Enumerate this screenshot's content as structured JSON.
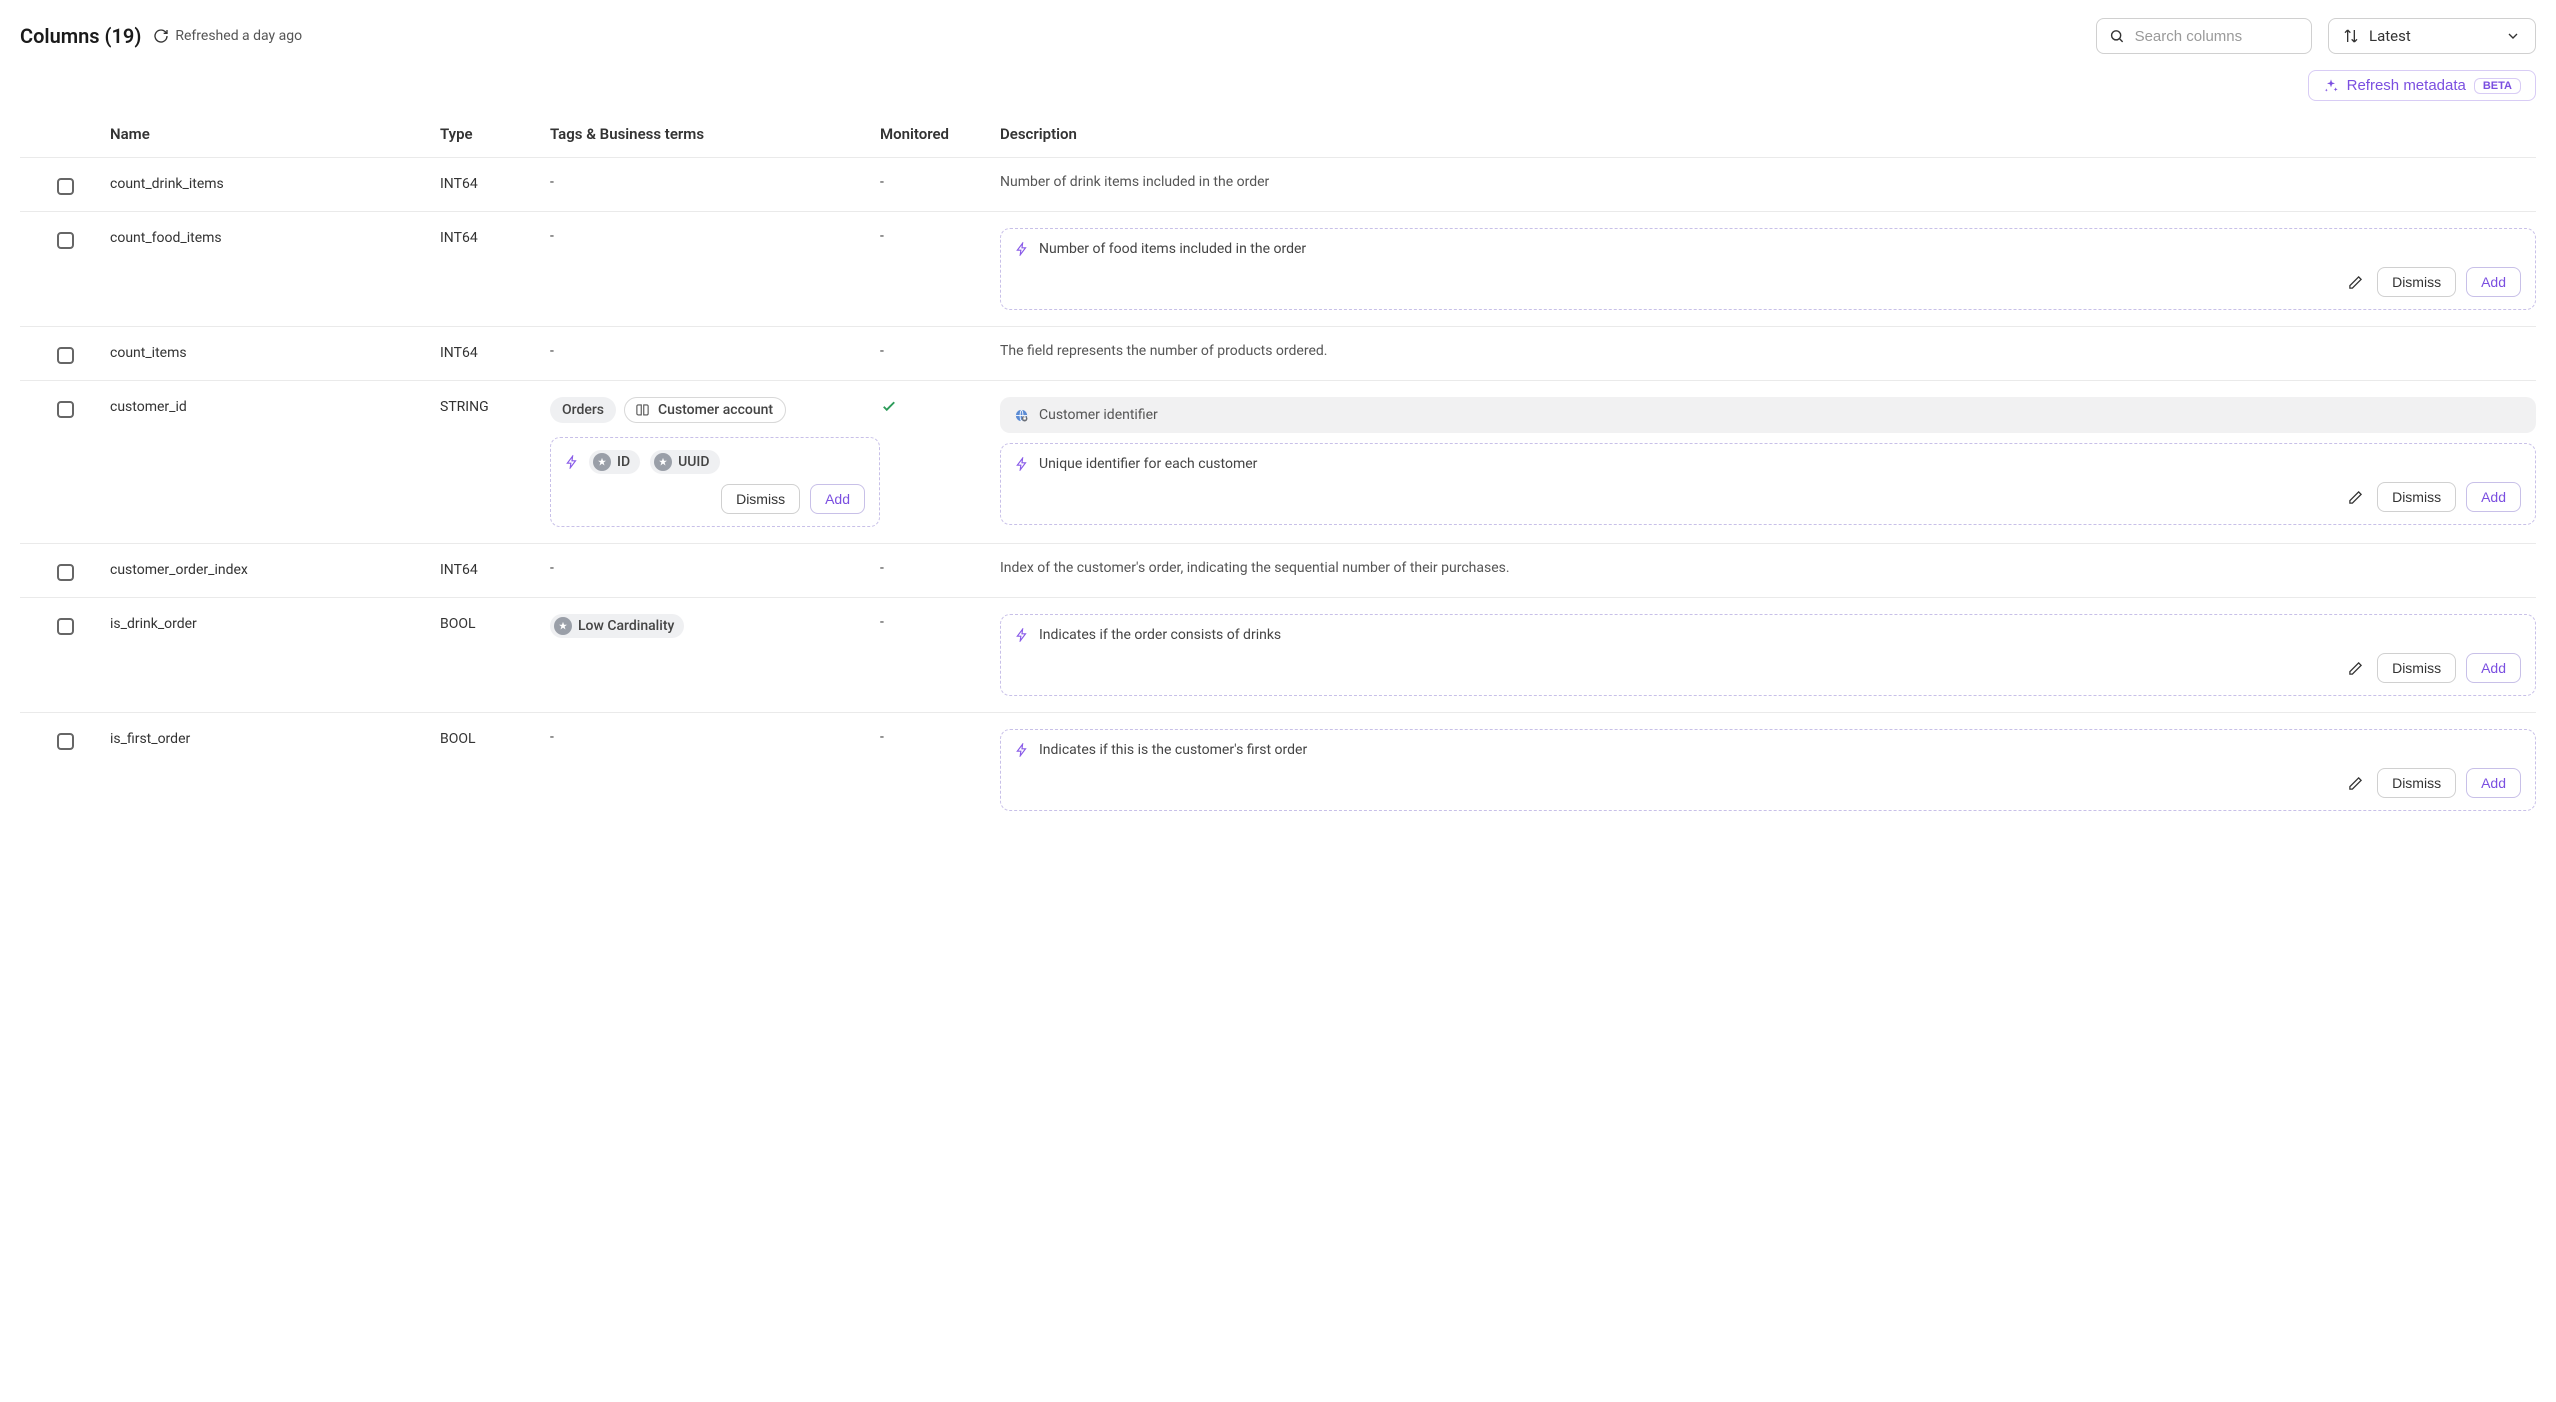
{
  "header": {
    "title": "Columns (19)",
    "refreshed": "Refreshed a day ago"
  },
  "search": {
    "placeholder": "Search columns"
  },
  "sort": {
    "label": "Latest"
  },
  "refresh_metadata": {
    "label": "Refresh metadata",
    "badge": "BETA"
  },
  "columns": {
    "name": "Name",
    "type": "Type",
    "tags": "Tags & Business terms",
    "monitored": "Monitored",
    "description": "Description"
  },
  "actions": {
    "dismiss": "Dismiss",
    "add": "Add"
  },
  "rows": [
    {
      "name": "count_drink_items",
      "type": "INT64",
      "tags": null,
      "monitored": null,
      "desc_plain": "Number of drink items included in the order"
    },
    {
      "name": "count_food_items",
      "type": "INT64",
      "tags": null,
      "monitored": null,
      "desc_suggestion": "Number of food items included in the order"
    },
    {
      "name": "count_items",
      "type": "INT64",
      "tags": null,
      "monitored": null,
      "desc_plain": "The field represents the number of products ordered."
    },
    {
      "name": "customer_id",
      "type": "STRING",
      "tags_simple": [
        "Orders"
      ],
      "tags_book": [
        "Customer account"
      ],
      "tags_ai": [
        "ID",
        "UUID"
      ],
      "monitored": true,
      "desc_gray": "Customer identifier",
      "desc_suggestion": "Unique identifier for each customer"
    },
    {
      "name": "customer_order_index",
      "type": "INT64",
      "tags": null,
      "monitored": null,
      "desc_plain": "Index of the customer's order, indicating the sequential number of their purchases."
    },
    {
      "name": "is_drink_order",
      "type": "BOOL",
      "tags_icon": [
        "Low Cardinality"
      ],
      "monitored": null,
      "desc_suggestion": "Indicates if the order consists of drinks"
    },
    {
      "name": "is_first_order",
      "type": "BOOL",
      "tags": null,
      "monitored": null,
      "desc_suggestion": "Indicates if this is the customer's first order"
    }
  ]
}
